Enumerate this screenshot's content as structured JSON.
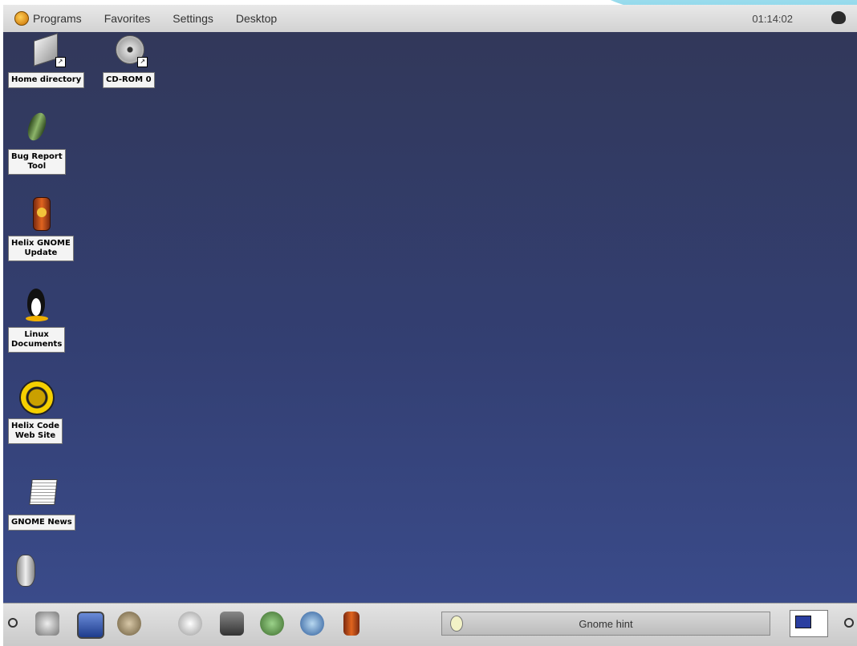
{
  "top_panel": {
    "menus": [
      {
        "label": "Programs"
      },
      {
        "label": "Favorites"
      },
      {
        "label": "Settings"
      },
      {
        "label": "Desktop"
      }
    ],
    "clock": "01:14:02"
  },
  "desktop": {
    "background_top": "#32385a",
    "background_bottom": "#3a4b8a",
    "icons": [
      {
        "label": "Home directory",
        "icon": "folder-icon"
      },
      {
        "label": "CD-ROM 0",
        "icon": "cdrom-icon"
      },
      {
        "label": "Bug Report\nTool",
        "icon": "bug-icon"
      },
      {
        "label": "Helix GNOME\nUpdate",
        "icon": "update-jar-icon"
      },
      {
        "label": "Linux\nDocuments",
        "icon": "tux-penguin-icon"
      },
      {
        "label": "Helix Code\nWeb Site",
        "icon": "helix-gear-icon"
      },
      {
        "label": "GNOME News",
        "icon": "newspaper-icon"
      },
      {
        "label": "",
        "icon": "gnome-foot-icon"
      }
    ]
  },
  "bottom_panel": {
    "launchers": [
      "gnome-foot-menu-icon",
      "monitor-icon",
      "shell-icon",
      "help-icon",
      "settings-icon",
      "mail-icon",
      "web-browser-icon",
      "update-jar-icon"
    ],
    "hint_text": "Gnome hint"
  }
}
